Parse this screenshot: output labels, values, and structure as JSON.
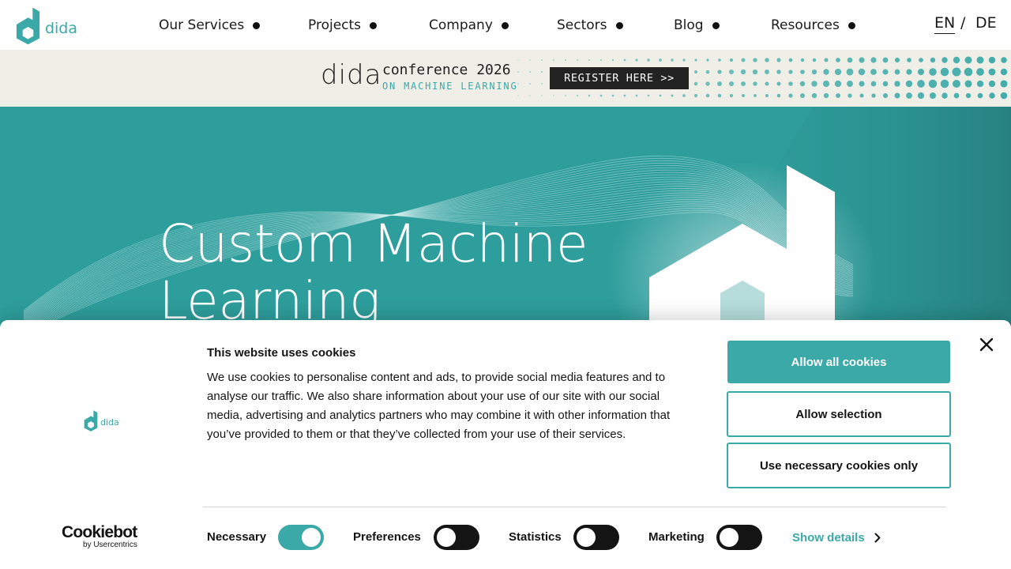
{
  "nav": {
    "logo_text": "dida",
    "items": [
      {
        "label": "Our Services"
      },
      {
        "label": "Projects"
      },
      {
        "label": "Company"
      },
      {
        "label": "Sectors"
      },
      {
        "label": "Blog"
      },
      {
        "label": "Resources"
      }
    ],
    "languages": {
      "active": "EN",
      "separator": "/",
      "other": "DE"
    }
  },
  "banner": {
    "logo_text": "dida",
    "title": "conference 2026",
    "subtitle": "ON MACHINE LEARNING",
    "cta": "REGISTER HERE >>"
  },
  "hero": {
    "title_line1": "Custom Machine",
    "title_line2": "Learning"
  },
  "cookie_dialog": {
    "logo_text": "dida",
    "title": "This website uses cookies",
    "body": "We use cookies to personalise content and ads, to provide social media features and to analyse our traffic. We also share information about your use of our site with our social media, advertising and analytics partners who may combine it with other information that you’ve provided to them or that they’ve collected from your use of their services.",
    "buttons": {
      "allow_all": "Allow all cookies",
      "allow_selection": "Allow selection",
      "necessary_only": "Use necessary cookies only"
    },
    "toggles": [
      {
        "label": "Necessary",
        "on": true
      },
      {
        "label": "Preferences",
        "on": false
      },
      {
        "label": "Statistics",
        "on": false
      },
      {
        "label": "Marketing",
        "on": false
      }
    ],
    "show_details": "Show details",
    "branding": {
      "name": "Cookiebot",
      "by": "by Usercentrics"
    }
  },
  "colors": {
    "accent": "#3aa9a8",
    "hero_bg": "#2e9e9c",
    "banner_bg": "#efeee7",
    "dark": "#141414"
  },
  "icons": [
    "dida-logo-icon",
    "nav-dot-icon",
    "close-icon",
    "chevron-right-icon",
    "cookiebot-logo"
  ]
}
